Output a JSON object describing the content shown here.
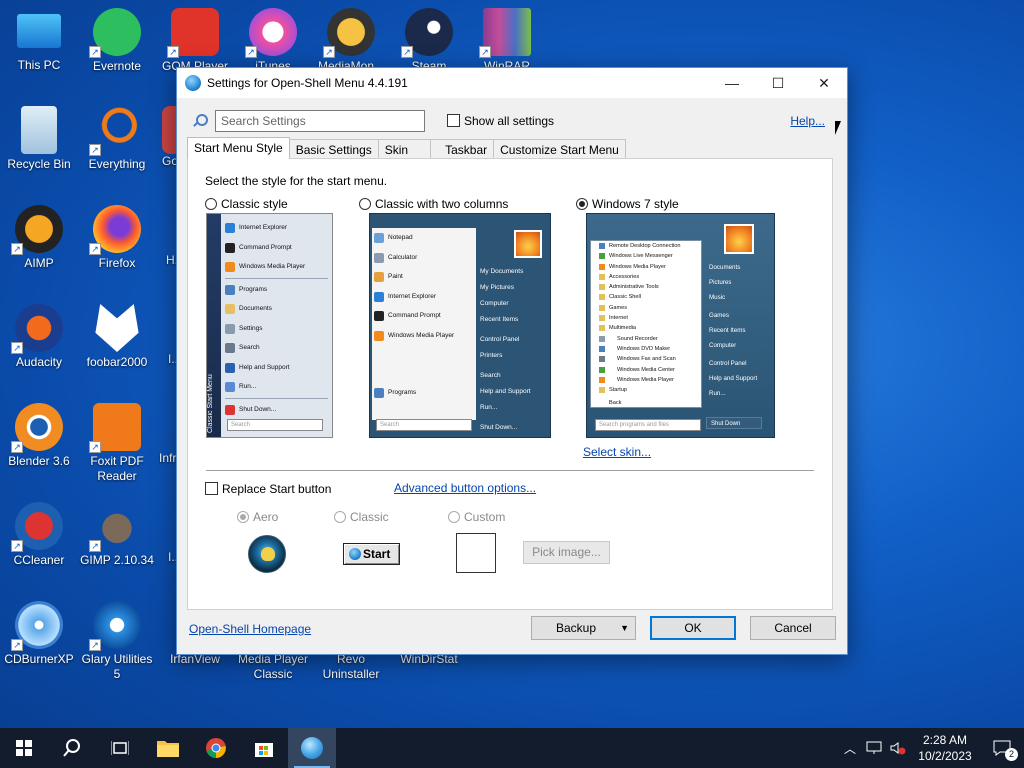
{
  "desktop": {
    "icons": [
      {
        "label": "This PC"
      },
      {
        "label": "Evernote"
      },
      {
        "label": "GOM Player"
      },
      {
        "label": "iTunes"
      },
      {
        "label": "MediaMon..."
      },
      {
        "label": "Steam"
      },
      {
        "label": "WinRAR"
      },
      {
        "label": "Recycle Bin"
      },
      {
        "label": "Everything"
      },
      {
        "label": "Go..."
      },
      {
        "label": "AIMP"
      },
      {
        "label": "Firefox"
      },
      {
        "label": "H..."
      },
      {
        "label": "Audacity"
      },
      {
        "label": "foobar2000"
      },
      {
        "label": "I..."
      },
      {
        "label": "Blender 3.6"
      },
      {
        "label": "Foxit PDF Reader"
      },
      {
        "label": "Infr..."
      },
      {
        "label": "CCleaner"
      },
      {
        "label": "GIMP 2.10.34"
      },
      {
        "label": "I..."
      },
      {
        "label": "CDBurnerXP"
      },
      {
        "label": "Glary Utilities 5"
      },
      {
        "label": "IrfanView"
      },
      {
        "label": "Media Player Classic"
      },
      {
        "label": "Revo Uninstaller"
      },
      {
        "label": "WinDirStat"
      }
    ]
  },
  "window": {
    "title": "Settings for Open-Shell Menu 4.4.191",
    "minimize": "—",
    "maximize": "☐",
    "close": "✕",
    "search_placeholder": "Search Settings",
    "show_all_label": "Show all settings",
    "help_link": "Help...",
    "tabs": [
      {
        "label": "Start Menu Style",
        "active": true
      },
      {
        "label": "Basic Settings"
      },
      {
        "label": "Skin"
      },
      {
        "label": "Taskbar"
      },
      {
        "label": "Customize Start Menu"
      }
    ],
    "panel": {
      "heading": "Select the style for the start menu.",
      "styles": [
        {
          "label": "Classic style",
          "selected": false
        },
        {
          "label": "Classic with two columns",
          "selected": false
        },
        {
          "label": "Windows 7 style",
          "selected": true
        }
      ],
      "classic_preview": {
        "side_text": "Classic Start Menu",
        "items": [
          "Internet Explorer",
          "Command Prompt",
          "Windows Media Player",
          "Programs",
          "Documents",
          "Settings",
          "Search",
          "Help and Support",
          "Run...",
          "Shut Down..."
        ],
        "search": "Search"
      },
      "two_col_preview": {
        "left_items": [
          "Notepad",
          "Calculator",
          "Paint",
          "Internet Explorer",
          "Command Prompt",
          "Windows Media Player"
        ],
        "programs": "Programs",
        "right_items": [
          "My Documents",
          "My Pictures",
          "Computer",
          "Recent Items",
          "Control Panel",
          "Printers",
          "Search",
          "Help and Support",
          "Run...",
          "Shut Down..."
        ],
        "search": "Search"
      },
      "win7_preview": {
        "left_items": [
          "Remote Desktop Connection",
          "Windows Live Messenger",
          "Windows Media Player",
          "Accessories",
          "Administrative Tools",
          "Classic Shell",
          "Games",
          "Internet",
          "Multimedia",
          "Sound Recorder",
          "Windows DVD Maker",
          "Windows Fax and Scan",
          "Windows Media Center",
          "Windows Media Player",
          "Startup",
          "Back"
        ],
        "right_items": [
          "Documents",
          "Pictures",
          "Music",
          "Games",
          "Recent Items",
          "Computer",
          "Control Panel",
          "Help and Support",
          "Run..."
        ],
        "search": "Search programs and files",
        "shutdown": "Shut Down"
      },
      "select_skin": "Select skin...",
      "replace_start": "Replace Start button",
      "advanced_options": "Advanced button options...",
      "button_styles": [
        {
          "label": "Aero",
          "selected": true
        },
        {
          "label": "Classic",
          "selected": false
        },
        {
          "label": "Custom",
          "selected": false
        }
      ],
      "classic_button_text": "Start",
      "pick_image": "Pick image..."
    },
    "homepage_link": "Open-Shell Homepage",
    "backup_label": "Backup",
    "ok_label": "OK",
    "cancel_label": "Cancel"
  },
  "taskbar": {
    "time": "2:28 AM",
    "date": "10/2/2023",
    "notification_count": "2"
  }
}
